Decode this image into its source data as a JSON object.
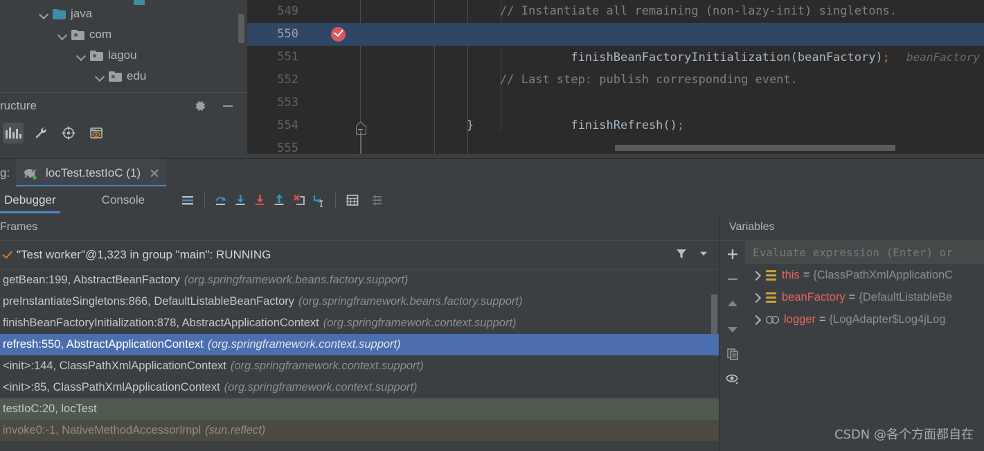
{
  "project_tree": {
    "items": [
      {
        "label": "java",
        "kind": "source-folder",
        "indent": 0
      },
      {
        "label": "com",
        "kind": "package-folder",
        "indent": 1
      },
      {
        "label": "lagou",
        "kind": "package-folder",
        "indent": 2
      },
      {
        "label": "edu",
        "kind": "package-folder",
        "indent": 3
      }
    ]
  },
  "structure_panel": {
    "title": "ructure",
    "gear_icon": "gear-icon",
    "minimize_icon": "minimize-icon",
    "toolbar": [
      {
        "name": "bar-chart-icon",
        "active": true
      },
      {
        "name": "wrench-icon",
        "active": false
      },
      {
        "name": "crosshair-icon",
        "active": false
      },
      {
        "name": "browser-preview-icon",
        "active": false
      }
    ]
  },
  "editor": {
    "lines": [
      {
        "number": "549",
        "current": false,
        "breakpoint": false,
        "segments": [
          {
            "text": "// Instantiate all remaining (non-lazy-init) singletons.",
            "cls": "c-comment"
          }
        ]
      },
      {
        "number": "550",
        "current": true,
        "breakpoint": true,
        "segments": [
          {
            "text": "finishBeanFactoryInitialization(beanFactory)",
            "cls": "c-method"
          },
          {
            "text": ";",
            "cls": "c-semi"
          }
        ],
        "inline_hint": "beanFactory"
      },
      {
        "number": "551",
        "current": false,
        "breakpoint": false,
        "segments": []
      },
      {
        "number": "552",
        "current": false,
        "breakpoint": false,
        "segments": [
          {
            "text": "// Last step: publish corresponding event.",
            "cls": "c-comment"
          }
        ]
      },
      {
        "number": "553",
        "current": false,
        "breakpoint": false,
        "segments": [
          {
            "text": "finishRefresh()",
            "cls": "c-method"
          },
          {
            "text": ";",
            "cls": "c-semi"
          }
        ]
      },
      {
        "number": "554",
        "current": false,
        "breakpoint": false,
        "brace": "}",
        "segments": []
      },
      {
        "number": "555",
        "current": false,
        "breakpoint": false,
        "segments": []
      }
    ]
  },
  "run_tabbar": {
    "run_label": "g:",
    "tab": {
      "label": "locTest.testIoC (1)",
      "icon": "gradle-elephant-icon",
      "status": "running",
      "close_icon": "close-icon"
    }
  },
  "debugger_toolbar": {
    "tabs": [
      {
        "label": "Debugger",
        "active": true
      },
      {
        "label": "Console",
        "active": false
      }
    ],
    "buttons": [
      {
        "name": "show-execution-point-icon"
      },
      {
        "name": "step-over-icon"
      },
      {
        "name": "step-into-icon"
      },
      {
        "name": "force-step-into-icon"
      },
      {
        "name": "step-out-icon"
      },
      {
        "name": "drop-frame-icon"
      },
      {
        "name": "run-to-cursor-icon"
      },
      {
        "name": "evaluate-expression-icon"
      },
      {
        "name": "settings-list-icon"
      }
    ]
  },
  "frames_panel": {
    "title": "Frames",
    "thread": {
      "label": "\"Test worker\"@1,323 in group \"main\": RUNNING",
      "status_icon": "running-check-icon",
      "filter_icon": "filter-icon",
      "dropdown_icon": "chevron-down-icon"
    },
    "frames": [
      {
        "method": "getBean:199, AbstractBeanFactory",
        "package": "(org.springframework.beans.factory.support)",
        "state": "normal"
      },
      {
        "method": "preInstantiateSingletons:866, DefaultListableBeanFactory",
        "package": "(org.springframework.beans.factory.support)",
        "state": "normal"
      },
      {
        "method": "finishBeanFactoryInitialization:878, AbstractApplicationContext",
        "package": "(org.springframework.context.support)",
        "state": "normal"
      },
      {
        "method": "refresh:550, AbstractApplicationContext",
        "package": "(org.springframework.context.support)",
        "state": "selected"
      },
      {
        "method": "<init>:144, ClassPathXmlApplicationContext",
        "package": "(org.springframework.context.support)",
        "state": "normal"
      },
      {
        "method": "<init>:85, ClassPathXmlApplicationContext",
        "package": "(org.springframework.context.support)",
        "state": "normal"
      },
      {
        "method": "testIoC:20, locTest",
        "package": "",
        "state": "usercode"
      },
      {
        "method": "invoke0:-1, NativeMethodAccessorImpl",
        "package": "(sun.reflect)",
        "state": "dim"
      }
    ]
  },
  "variables_panel": {
    "title": "Variables",
    "evaluate_placeholder": "Evaluate expression (Enter) or",
    "sidebar_buttons": [
      {
        "name": "add-watch-icon"
      },
      {
        "name": "remove-watch-icon"
      },
      {
        "name": "move-up-icon"
      },
      {
        "name": "move-down-icon"
      },
      {
        "name": "copy-icon"
      },
      {
        "name": "inspect-eye-icon"
      }
    ],
    "variables": [
      {
        "icon": "field-icon",
        "name": "this",
        "eq": "=",
        "value": "{ClassPathXmlApplicationC"
      },
      {
        "icon": "field-icon",
        "name": "beanFactory",
        "eq": "=",
        "value": "{DefaultListableBe"
      },
      {
        "icon": "static-field-icon",
        "name": "logger",
        "eq": "=",
        "value": "{LogAdapter$Log4jLog"
      }
    ]
  },
  "watermark": {
    "text": "CSDN @各个方面都自在"
  },
  "colors": {
    "bg": "#3c3f41",
    "editor_bg": "#2b2b2b",
    "selection_blue": "#4b6eaf",
    "current_line": "#2f4664",
    "accent_blue": "#4a88c7",
    "breakpoint_red": "#db5860",
    "var_name_red": "#e8665c",
    "field_gold": "#c9a23a"
  }
}
